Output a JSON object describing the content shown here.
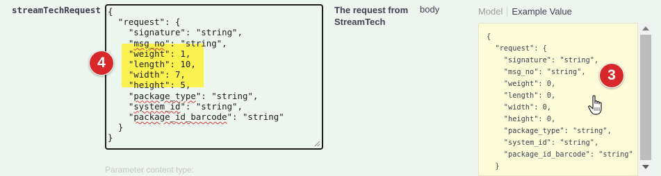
{
  "param": {
    "name": "streamTechRequest",
    "description": "The request from StreamTech",
    "in": "body",
    "content_type_label": "Parameter content type:"
  },
  "editor": {
    "lines": [
      "{",
      "  \"request\": {",
      "    \"signature\": \"string\",",
      "    \"msg_no\": \"string\",",
      "    \"weight\": 1,",
      "    \"length\": 10,",
      "    \"width\": 7,",
      "    \"height\": 5,",
      "    \"package_type\": \"string\",",
      "    \"system_id\": \"string\",",
      "    \"package_id_barcode\": \"string\"",
      "  }",
      "}"
    ]
  },
  "tabs": {
    "model": "Model",
    "example": "Example Value"
  },
  "example": {
    "text": "{\n  \"request\": {\n    \"signature\": \"string\",\n    \"msg_no\": \"string\",\n    \"weight\": 0,\n    \"length\": 0,\n    \"width\": 0,\n    \"height\": 0,\n    \"package_type\": \"string\",\n    \"system_id\": \"string\",\n    \"package_id_barcode\": \"string\"\n  }"
  },
  "annotations": {
    "badge_editor": "4",
    "badge_example": "3"
  },
  "colors": {
    "highlight": "#fbf24f",
    "badge": "#d7282b",
    "example_bg": "#fdfcd9",
    "page_bg": "#edf6ee"
  }
}
